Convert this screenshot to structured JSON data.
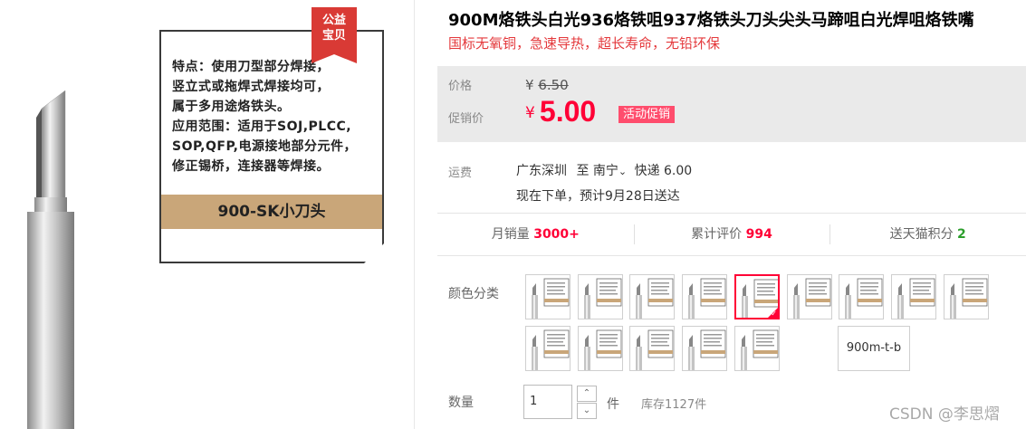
{
  "image_panel": {
    "badge_line1": "公益",
    "badge_line2": "宝贝",
    "feature_lines": [
      "特点：使用刀型部分焊接，",
      "竖立式或拖焊式焊接均可，",
      "属于多用途烙铁头。",
      "应用范围：适用于SOJ,PLCC,",
      "SOP,QFP,电源接地部分元件，",
      "修正锡桥，连接器等焊接。"
    ],
    "model_band": "900-SK小刀头"
  },
  "product": {
    "title": "900M烙铁头白光936烙铁咀937烙铁头刀头尖头马蹄咀白光焊咀烙铁嘴",
    "subtitle": "国标无氧铜，急速导热，超长寿命，无铅环保"
  },
  "price": {
    "label": "价格",
    "currency": "¥",
    "original": "6.50",
    "promo_label": "促销价",
    "promo": "5.00",
    "promo_tag": "活动促销"
  },
  "shipping": {
    "label": "运费",
    "from": "广东深圳",
    "to_word": "至",
    "to": "南宁",
    "method": "快递 6.00",
    "delivery": "现在下单，预计9月28日送达"
  },
  "stats": {
    "monthly_sales_label": "月销量",
    "monthly_sales": "3000+",
    "reviews_label": "累计评价",
    "reviews": "994",
    "points_label": "送天猫积分",
    "points": "2"
  },
  "sku": {
    "label": "颜色分类",
    "thumbnail_count": 14,
    "selected_index": 4,
    "text_option": "900m-t-b"
  },
  "quantity": {
    "label": "数量",
    "value": "1",
    "unit": "件",
    "stock": "库存1127件"
  },
  "watermark": "CSDN @李思熠",
  "colors": {
    "accent": "#ff0036",
    "subtitle": "#e4393c",
    "band": "#c9a679",
    "badge": "#d93a35",
    "price_bg": "#eaeaea"
  }
}
